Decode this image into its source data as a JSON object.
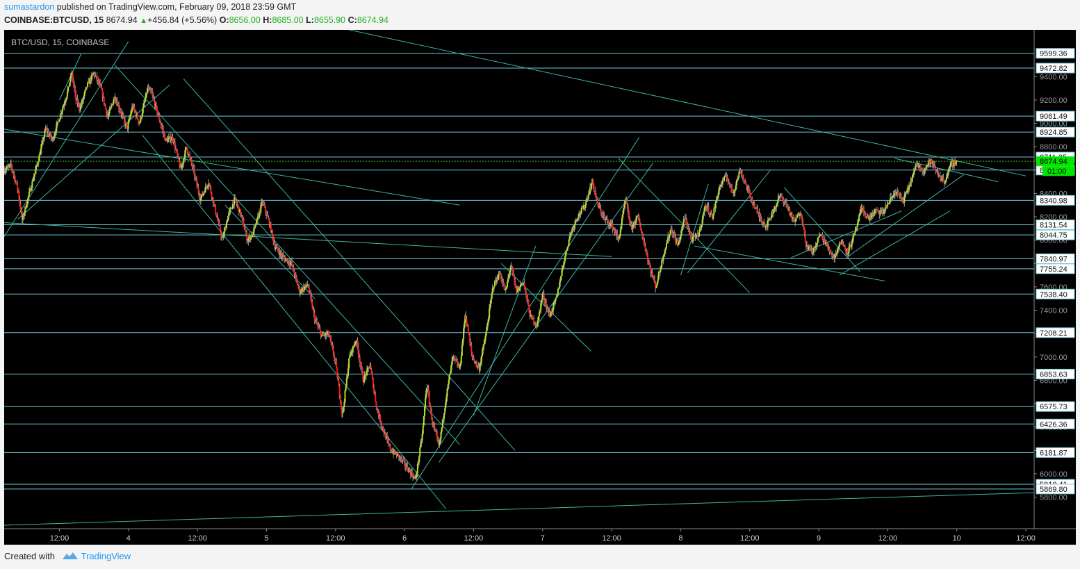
{
  "header": {
    "author": "sumastardon",
    "published_text": "published on TradingView.com, February 09, 2018 23:59 GMT",
    "symbol": "COINBASE:BTCUSD, 15",
    "last": "8674.94",
    "change": "+456.84 (+5.56%)",
    "o_label": "O:",
    "o_value": "8656.00",
    "h_label": "H:",
    "h_value": "8685.00",
    "l_label": "L:",
    "l_value": "8655.90",
    "c_label": "C:",
    "c_value": "8674.94"
  },
  "footer": {
    "created_with": "Created with",
    "brand": "TradingView"
  },
  "colors": {
    "background": "#000000",
    "up_candle": "#b5e61d",
    "down_candle": "#ff1a1a",
    "wick": "#9a9a9a",
    "trendline": "#3fb6a0",
    "hline": "#6fc7d6",
    "price_line": "#4cbb17",
    "price_label_bg": "#00e600"
  },
  "chart_data": {
    "type": "candlestick",
    "title": "BTC/USD, 15, COINBASE",
    "ylim": [
      5530,
      9800
    ],
    "x_ticks": [
      "12:00",
      "4",
      "12:00",
      "5",
      "12:00",
      "6",
      "12:00",
      "7",
      "12:00",
      "8",
      "12:00",
      "9",
      "12:00",
      "10",
      "12:00"
    ],
    "y_ticks": [
      5800,
      6000,
      6200,
      6400,
      6600,
      6800,
      7000,
      7200,
      7400,
      7600,
      7800,
      8000,
      8200,
      8400,
      8600,
      8800,
      9000,
      9200,
      9400
    ],
    "horizontal_levels": [
      9599.36,
      9472.82,
      9061.49,
      8924.85,
      8711.35,
      8600.0,
      8340.98,
      8131.54,
      8044.75,
      7840.97,
      7755.24,
      7538.4,
      7208.21,
      6853.63,
      6575.73,
      6426.36,
      6181.87,
      5910.41,
      5869.8
    ],
    "level_labels": [
      "9599.36",
      "9472.82",
      "9061.49",
      "8924.85",
      "8711.35",
      "8600.00",
      "8340.98",
      "8131.54",
      "8044.75",
      "7840.97",
      "7755.24",
      "7538.40",
      "7208.21",
      "6853.63",
      "6575.73",
      "6426.36",
      "6181.87",
      "5910.41",
      "5869.80"
    ],
    "current_price": 8674.94,
    "current_price_label": "8674.94",
    "countdown_label": "01:00",
    "price_path": [
      [
        0,
        8600
      ],
      [
        0.5,
        8640
      ],
      [
        1,
        8430
      ],
      [
        1.3,
        8170
      ],
      [
        1.7,
        8350
      ],
      [
        2.5,
        8700
      ],
      [
        3,
        8950
      ],
      [
        3.5,
        8860
      ],
      [
        4,
        9050
      ],
      [
        4.5,
        9230
      ],
      [
        4.9,
        9430
      ],
      [
        5.2,
        9200
      ],
      [
        5.5,
        9130
      ],
      [
        6,
        9320
      ],
      [
        6.5,
        9430
      ],
      [
        7,
        9300
      ],
      [
        7.5,
        9050
      ],
      [
        8,
        9230
      ],
      [
        8.5,
        9080
      ],
      [
        8.9,
        8950
      ],
      [
        9.3,
        9150
      ],
      [
        9.8,
        9000
      ],
      [
        10.4,
        9300
      ],
      [
        10.7,
        9250
      ],
      [
        11.2,
        9050
      ],
      [
        11.7,
        8850
      ],
      [
        12.2,
        8880
      ],
      [
        12.8,
        8600
      ],
      [
        13.2,
        8800
      ],
      [
        13.7,
        8600
      ],
      [
        14.2,
        8350
      ],
      [
        14.8,
        8500
      ],
      [
        15.2,
        8300
      ],
      [
        15.8,
        8000
      ],
      [
        16.2,
        8200
      ],
      [
        16.7,
        8350
      ],
      [
        17.2,
        8200
      ],
      [
        17.6,
        8000
      ],
      [
        18,
        8050
      ],
      [
        18.4,
        8200
      ],
      [
        18.7,
        8330
      ],
      [
        19.2,
        8150
      ],
      [
        19.6,
        7950
      ],
      [
        20.2,
        7850
      ],
      [
        20.8,
        7800
      ],
      [
        21.4,
        7560
      ],
      [
        22,
        7620
      ],
      [
        22.5,
        7320
      ],
      [
        23,
        7180
      ],
      [
        23.5,
        7200
      ],
      [
        24,
        6950
      ],
      [
        24.5,
        6500
      ],
      [
        25,
        7000
      ],
      [
        25.5,
        7150
      ],
      [
        26,
        6800
      ],
      [
        26.5,
        6930
      ],
      [
        27,
        6550
      ],
      [
        27.5,
        6360
      ],
      [
        28,
        6200
      ],
      [
        28.6,
        6150
      ],
      [
        29.2,
        6050
      ],
      [
        29.8,
        5950
      ],
      [
        30.3,
        6350
      ],
      [
        30.6,
        6770
      ],
      [
        31,
        6450
      ],
      [
        31.5,
        6230
      ],
      [
        32,
        6650
      ],
      [
        32.5,
        7000
      ],
      [
        33,
        6900
      ],
      [
        33.4,
        7370
      ],
      [
        33.9,
        7000
      ],
      [
        34.4,
        6900
      ],
      [
        34.9,
        7200
      ],
      [
        35.4,
        7600
      ],
      [
        35.9,
        7720
      ],
      [
        36.3,
        7550
      ],
      [
        36.7,
        7790
      ],
      [
        37.1,
        7560
      ],
      [
        37.6,
        7650
      ],
      [
        38.1,
        7350
      ],
      [
        38.6,
        7270
      ],
      [
        39,
        7540
      ],
      [
        39.5,
        7350
      ],
      [
        40,
        7500
      ],
      [
        40.5,
        7800
      ],
      [
        41,
        8050
      ],
      [
        41.5,
        8200
      ],
      [
        42,
        8280
      ],
      [
        42.6,
        8500
      ],
      [
        43,
        8300
      ],
      [
        43.5,
        8180
      ],
      [
        44,
        8130
      ],
      [
        44.5,
        8000
      ],
      [
        45,
        8350
      ],
      [
        45.4,
        8100
      ],
      [
        45.9,
        8200
      ],
      [
        46.4,
        7950
      ],
      [
        46.8,
        7750
      ],
      [
        47.2,
        7600
      ],
      [
        47.8,
        7900
      ],
      [
        48.3,
        8100
      ],
      [
        48.8,
        7950
      ],
      [
        49.3,
        8200
      ],
      [
        49.8,
        8000
      ],
      [
        50.3,
        8050
      ],
      [
        50.8,
        8300
      ],
      [
        51.3,
        8200
      ],
      [
        51.8,
        8450
      ],
      [
        52.3,
        8550
      ],
      [
        52.8,
        8400
      ],
      [
        53.3,
        8600
      ],
      [
        53.8,
        8450
      ],
      [
        54.3,
        8300
      ],
      [
        54.8,
        8180
      ],
      [
        55.2,
        8120
      ],
      [
        55.7,
        8250
      ],
      [
        56.2,
        8380
      ],
      [
        56.7,
        8300
      ],
      [
        57.2,
        8150
      ],
      [
        57.7,
        8250
      ],
      [
        58.1,
        7950
      ],
      [
        58.6,
        7900
      ],
      [
        59.1,
        8050
      ],
      [
        59.6,
        7950
      ],
      [
        60.1,
        7850
      ],
      [
        60.6,
        7990
      ],
      [
        61.1,
        7900
      ],
      [
        61.6,
        8050
      ],
      [
        62.1,
        8270
      ],
      [
        62.6,
        8180
      ],
      [
        63.1,
        8250
      ],
      [
        63.6,
        8230
      ],
      [
        64.1,
        8330
      ],
      [
        64.6,
        8420
      ],
      [
        65.1,
        8330
      ],
      [
        65.6,
        8480
      ],
      [
        66.1,
        8650
      ],
      [
        66.6,
        8600
      ],
      [
        67.1,
        8680
      ],
      [
        67.6,
        8570
      ],
      [
        68.1,
        8500
      ],
      [
        68.6,
        8650
      ],
      [
        69,
        8674.94
      ]
    ],
    "x_index_at_tick": [
      4,
      9,
      14,
      19,
      24,
      29,
      34,
      39,
      44,
      49,
      54,
      59,
      64,
      69,
      74
    ],
    "x_index_range": [
      0,
      74.6
    ],
    "trendlines": [
      {
        "x1": 0,
        "y1": 8950,
        "x2": 33,
        "y2": 8300
      },
      {
        "x1": 0,
        "y1": 8150,
        "x2": 44,
        "y2": 7860
      },
      {
        "x1": 25,
        "y1": 9800,
        "x2": 74,
        "y2": 8550
      },
      {
        "x1": 0,
        "y1": 8030,
        "x2": 9,
        "y2": 9700
      },
      {
        "x1": 1,
        "y1": 8180,
        "x2": 12,
        "y2": 9330
      },
      {
        "x1": 4,
        "y1": 9200,
        "x2": 5.6,
        "y2": 9600
      },
      {
        "x1": 8,
        "y1": 9500,
        "x2": 33,
        "y2": 6250
      },
      {
        "x1": 10,
        "y1": 8900,
        "x2": 32,
        "y2": 5700
      },
      {
        "x1": 13,
        "y1": 9380,
        "x2": 37,
        "y2": 6200
      },
      {
        "x1": 16,
        "y1": 8300,
        "x2": 22.5,
        "y2": 7500
      },
      {
        "x1": 29.5,
        "y1": 5870,
        "x2": 46,
        "y2": 8880
      },
      {
        "x1": 31.5,
        "y1": 6100,
        "x2": 47,
        "y2": 8660
      },
      {
        "x1": 34,
        "y1": 6500,
        "x2": 38.5,
        "y2": 7950
      },
      {
        "x1": 36,
        "y1": 7800,
        "x2": 42.5,
        "y2": 7050
      },
      {
        "x1": 44.5,
        "y1": 8700,
        "x2": 54,
        "y2": 7550
      },
      {
        "x1": 49,
        "y1": 7700,
        "x2": 51,
        "y2": 8480
      },
      {
        "x1": 49.5,
        "y1": 7720,
        "x2": 55.5,
        "y2": 8600
      },
      {
        "x1": 50,
        "y1": 7950,
        "x2": 63.8,
        "y2": 7650
      },
      {
        "x1": 56.5,
        "y1": 8450,
        "x2": 62,
        "y2": 7730
      },
      {
        "x1": 57,
        "y1": 7850,
        "x2": 65,
        "y2": 8250
      },
      {
        "x1": 60.5,
        "y1": 7700,
        "x2": 68.5,
        "y2": 8250
      },
      {
        "x1": 61,
        "y1": 7850,
        "x2": 69.5,
        "y2": 8560
      },
      {
        "x1": 64.5,
        "y1": 8700,
        "x2": 72,
        "y2": 8500
      },
      {
        "x1": 0,
        "y1": 5560,
        "x2": 75,
        "y2": 5840
      }
    ]
  }
}
